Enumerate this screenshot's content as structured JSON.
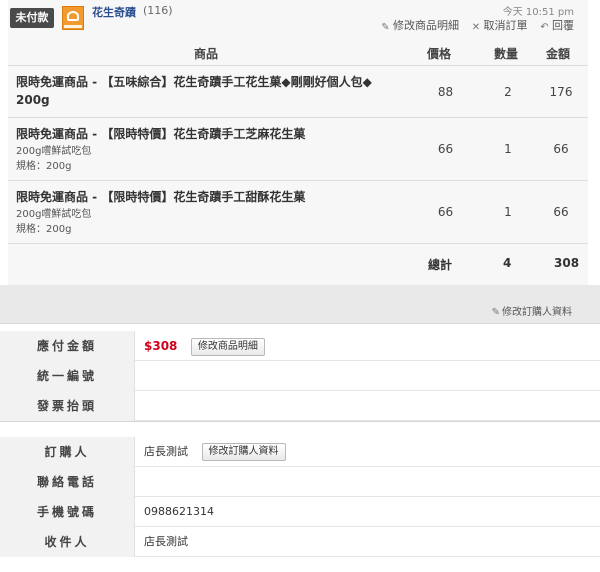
{
  "order": {
    "status_badge": "未付款",
    "store_name": "花生奇蹟",
    "store_count": "(116)",
    "timestamp": "今天  10:51 pm",
    "actions": {
      "edit_items": "修改商品明細",
      "cancel_order": "取消訂單",
      "reply": "回覆"
    }
  },
  "table": {
    "headers": {
      "item": "商品",
      "price": "價格",
      "qty": "數量",
      "amount": "金額"
    },
    "rows": [
      {
        "title_line1": "限時免運商品 - 【五味綜合】花生奇蹟手工花生菓◆剛剛好個人包◆",
        "title_line2": "200g",
        "sub1": "",
        "sub2": "",
        "price": "88",
        "qty": "2",
        "amount": "176"
      },
      {
        "title_line1": "限時免運商品 - 【限時特價】花生奇蹟手工芝麻花生菓",
        "title_line2": "",
        "sub1": "200g嚐鮮試吃包",
        "sub2": "規格：200g",
        "price": "66",
        "qty": "1",
        "amount": "66"
      },
      {
        "title_line1": "限時免運商品 - 【限時特價】花生奇蹟手工甜酥花生菓",
        "title_line2": "",
        "sub1": "200g嚐鮮試吃包",
        "sub2": "規格：200g",
        "price": "66",
        "qty": "1",
        "amount": "66"
      }
    ],
    "total": {
      "label": "總計",
      "qty": "4",
      "amount": "308"
    }
  },
  "edit_buyer_link": "修改訂購人資料",
  "payment": {
    "amount_label": "應付金額",
    "amount_value": "$308",
    "edit_items_button": "修改商品明細",
    "tax_id_label": "統一編號",
    "tax_id_value": "",
    "invoice_title_label": "發票抬頭",
    "invoice_title_value": ""
  },
  "buyer": {
    "buyer_label": "訂購人",
    "buyer_value": "店長測試",
    "edit_buyer_button": "修改訂購人資料",
    "phone_label": "聯絡電話",
    "phone_value": "",
    "mobile_label": "手機號碼",
    "mobile_value": "0988621314",
    "recipient_label": "收件人",
    "recipient_value": "店長測試"
  },
  "colors": {
    "badge": "#4a4a4a",
    "store_name": "#2b4f8f",
    "price": "#d0021b",
    "logo": "#f29a2e"
  },
  "icons": [
    "edit-icon",
    "cancel-icon",
    "reply-icon"
  ]
}
